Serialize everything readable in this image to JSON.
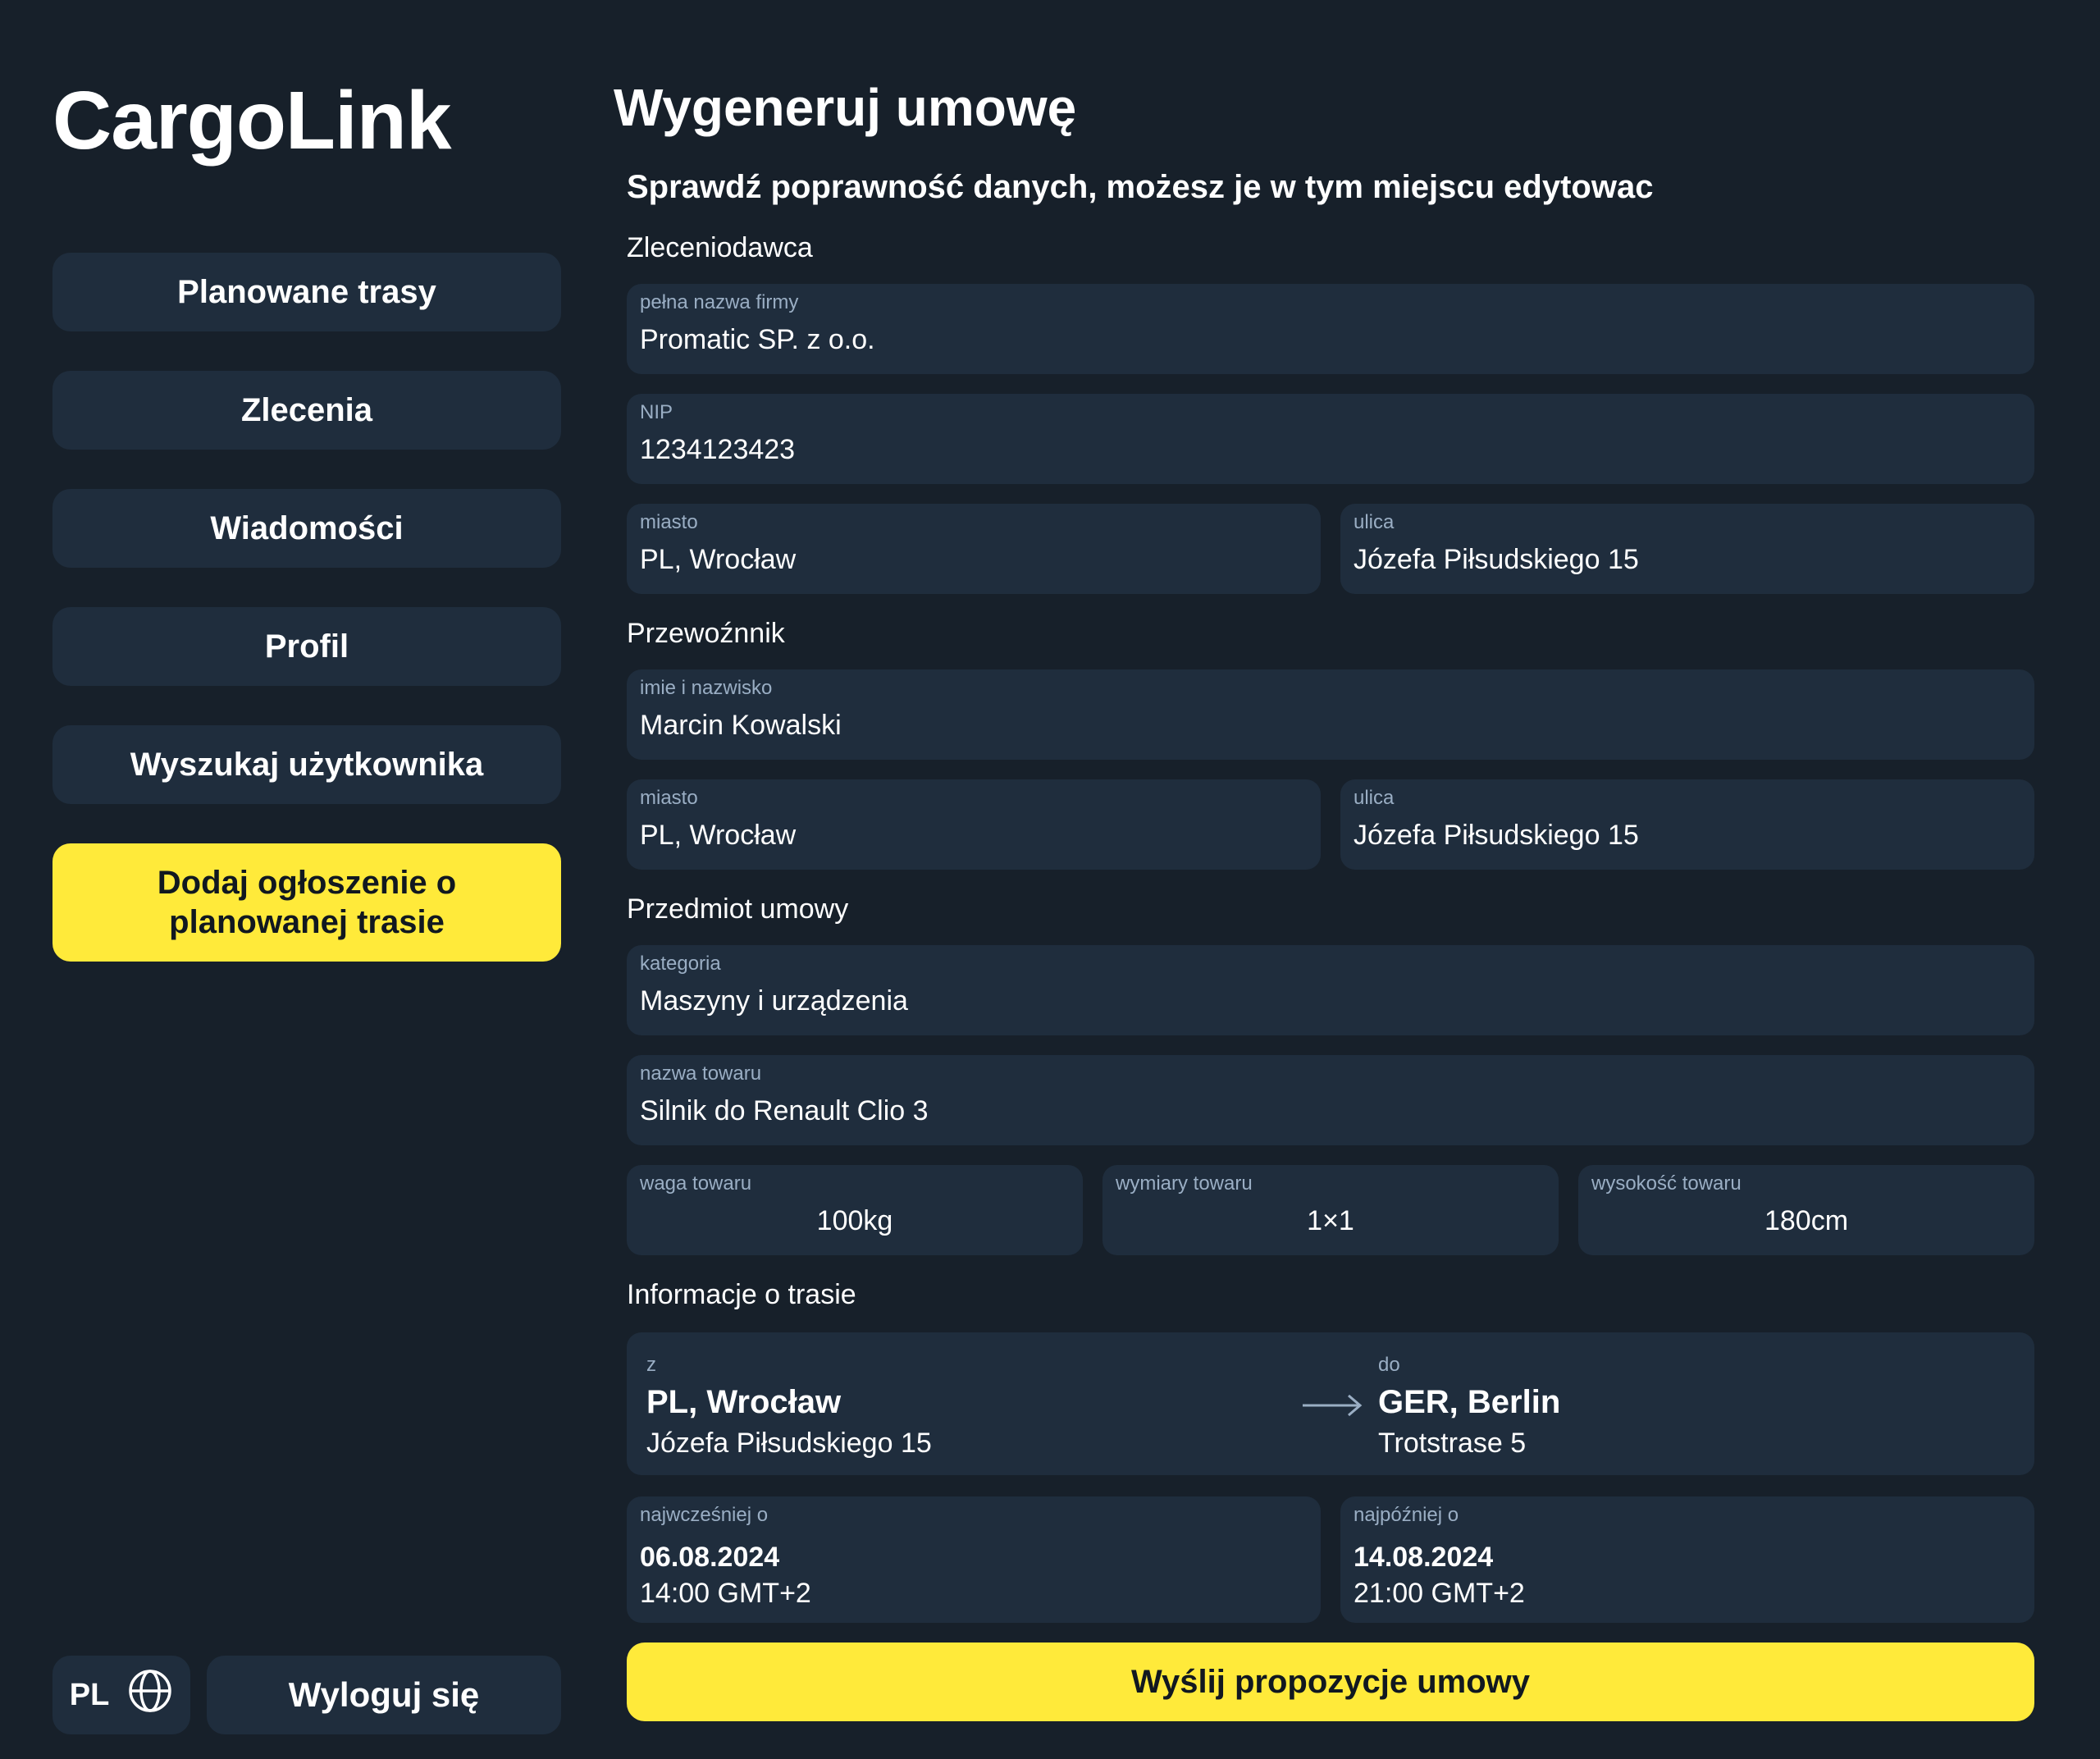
{
  "app": {
    "name": "CargoLink"
  },
  "sidebar": {
    "items": [
      {
        "label": "Planowane trasy"
      },
      {
        "label": "Zlecenia"
      },
      {
        "label": "Wiadomości"
      },
      {
        "label": "Profil"
      },
      {
        "label": "Wyszukaj użytkownika"
      }
    ],
    "primary_action": {
      "label": "Dodaj ogłoszenie o planowanej trasie"
    },
    "language": {
      "code": "PL",
      "icon": "globe-icon"
    },
    "logout_label": "Wyloguj się"
  },
  "page": {
    "title": "Wygeneruj umowę",
    "subtitle": "Sprawdź poprawność danych, możesz je w tym miejscu edytowac"
  },
  "client": {
    "section_label": "Zleceniodawca",
    "company": {
      "label": "pełna nazwa firmy",
      "value": "Promatic SP. z o.o."
    },
    "nip": {
      "label": "NIP",
      "value": "1234123423"
    },
    "city": {
      "label": "miasto",
      "value": "PL, Wrocław"
    },
    "street": {
      "label": "ulica",
      "value": "Józefa Piłsudskiego 15"
    }
  },
  "carrier": {
    "section_label": "Przewoźnnik",
    "name": {
      "label": "imie i nazwisko",
      "value": "Marcin Kowalski"
    },
    "city": {
      "label": "miasto",
      "value": "PL, Wrocław"
    },
    "street": {
      "label": "ulica",
      "value": "Józefa Piłsudskiego 15"
    }
  },
  "subject": {
    "section_label": "Przedmiot umowy",
    "category": {
      "label": "kategoria",
      "value": "Maszyny i urządzenia"
    },
    "goods_name": {
      "label": "nazwa towaru",
      "value": "Silnik do Renault Clio 3"
    },
    "weight": {
      "label": "waga towaru",
      "value": "100kg"
    },
    "dimensions": {
      "label": "wymiary towaru",
      "value": "1×1"
    },
    "height": {
      "label": "wysokość towaru",
      "value": "180cm"
    }
  },
  "route": {
    "section_label": "Informacje o trasie",
    "from": {
      "label": "z",
      "city": "PL, Wrocław",
      "street": "Józefa Piłsudskiego 15"
    },
    "to": {
      "label": "do",
      "city": "GER, Berlin",
      "street": "Trotstrase 5"
    },
    "arrow_icon": "arrow-right-icon",
    "earliest": {
      "label": "najwcześniej o",
      "date": "06.08.2024",
      "time": "14:00 GMT+2"
    },
    "latest": {
      "label": "najpóźniej o",
      "date": "14.08.2024",
      "time": "21:00 GMT+2"
    }
  },
  "submit_label": "Wyślij propozycje umowy",
  "colors": {
    "background": "#17202a",
    "panel": "#1f2d3d",
    "accent": "#ffea3a",
    "muted_label": "#9aaec4"
  }
}
